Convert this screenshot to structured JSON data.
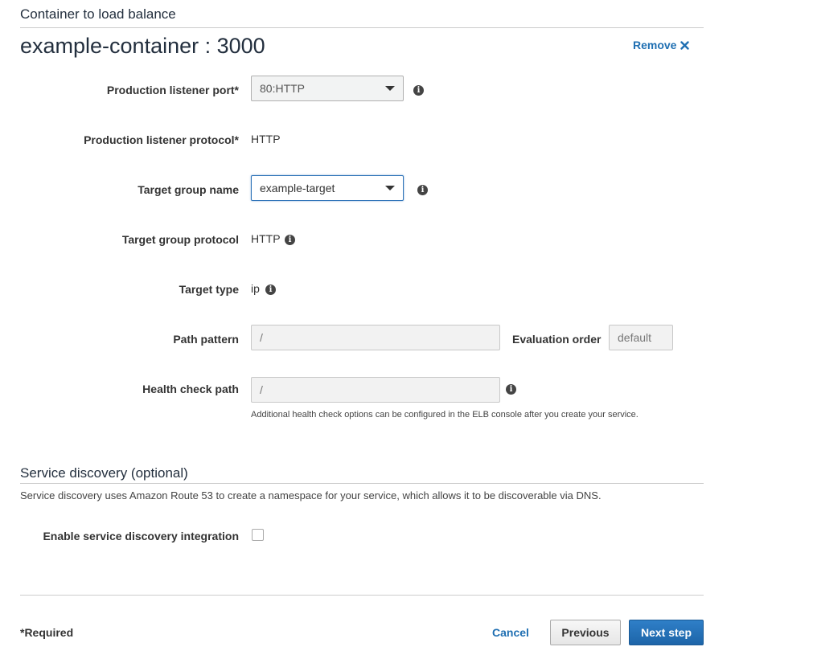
{
  "load_balancer": {
    "section_title": "Container to load balance",
    "container_name": "example-container : 3000",
    "remove_label": "Remove",
    "fields": {
      "listener_port": {
        "label": "Production listener port*",
        "value": "80:HTTP"
      },
      "listener_protocol": {
        "label": "Production listener protocol*",
        "value": "HTTP"
      },
      "target_group_name": {
        "label": "Target group name",
        "value": "example-target"
      },
      "target_group_protocol": {
        "label": "Target group protocol",
        "value": "HTTP"
      },
      "target_type": {
        "label": "Target type",
        "value": "ip"
      },
      "path_pattern": {
        "label": "Path pattern",
        "value": "/"
      },
      "evaluation_order": {
        "label": "Evaluation order",
        "value": "default"
      },
      "health_check_path": {
        "label": "Health check path",
        "value": "/",
        "hint": "Additional health check options can be configured in the ELB console after you create your service."
      }
    }
  },
  "service_discovery": {
    "section_title": "Service discovery (optional)",
    "description": "Service discovery uses Amazon Route 53 to create a namespace for your service, which allows it to be discoverable via DNS.",
    "enable_label": "Enable service discovery integration",
    "enabled": false
  },
  "footer": {
    "required_note": "*Required",
    "cancel_label": "Cancel",
    "previous_label": "Previous",
    "next_label": "Next step"
  },
  "colors": {
    "link": "#1f6fb2",
    "primary_button": "#1d65a8",
    "focus_border": "#2e73b8"
  }
}
